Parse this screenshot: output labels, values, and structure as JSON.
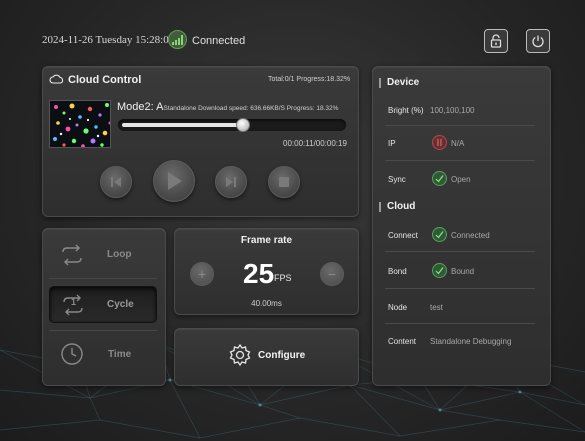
{
  "header": {
    "datetime": "2024-11-26 Tuesday 15:28:05",
    "connection_status": "Connected",
    "unlock_icon": "unlock-icon",
    "power_icon": "power-icon"
  },
  "cloud_control": {
    "title": "Cloud Control",
    "stats": "Total:0/1   Progress:18.32%",
    "mode_name": "Mode2:  A",
    "mode_detail": "Standalone Download speed: 636.66KB/S Progress: 18.32%",
    "progress": 0.5483,
    "time": "00:00:11/00:00:19",
    "controls": [
      {
        "name": "previous",
        "icon": "skip-previous-icon"
      },
      {
        "name": "play",
        "icon": "play-icon"
      },
      {
        "name": "next",
        "icon": "skip-next-icon"
      },
      {
        "name": "stop",
        "icon": "stop-icon"
      }
    ]
  },
  "play_modes": {
    "items": [
      {
        "label": "Loop",
        "icon": "loop-icon",
        "active": false
      },
      {
        "label": "Cycle",
        "icon": "repeat-one-icon",
        "badge": "1",
        "active": true
      },
      {
        "label": "Time",
        "icon": "clock-icon",
        "active": false
      }
    ]
  },
  "frame_rate": {
    "title": "Frame rate",
    "value": "25",
    "unit": "FPS",
    "interval": "40.00ms",
    "minus_symbol": "+",
    "plus_symbol": "−"
  },
  "configure": {
    "label": "Configure",
    "icon": "gear-icon"
  },
  "device": {
    "title": "Device",
    "rows": [
      {
        "label": "Bright (%)",
        "value": "100,100,100"
      },
      {
        "label": "IP",
        "value": "N/A",
        "status": "error"
      },
      {
        "label": "Sync",
        "value": "Open",
        "status": "ok"
      }
    ]
  },
  "cloud": {
    "title": "Cloud",
    "rows": [
      {
        "label": "Connect",
        "value": "Connected",
        "status": "ok"
      },
      {
        "label": "Bond",
        "value": "Bound",
        "status": "ok"
      },
      {
        "label": "Node",
        "value": "test"
      },
      {
        "label": "Content",
        "value": "Standalone Debugging"
      }
    ]
  },
  "colors": {
    "ok_green": "#3f8f4a",
    "error_red": "#9a3a3a",
    "panel": "#333333"
  }
}
